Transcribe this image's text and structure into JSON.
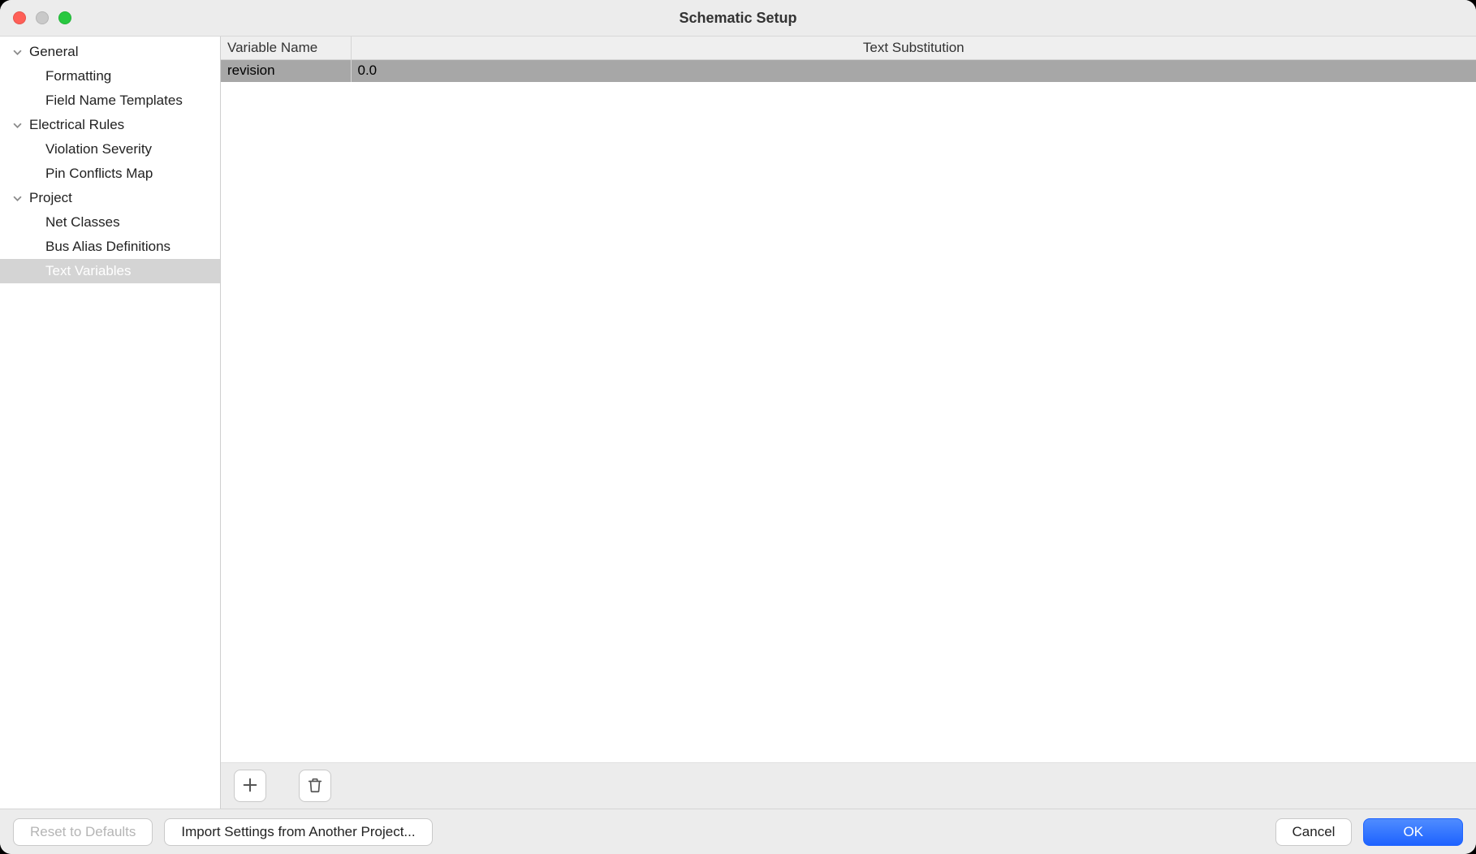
{
  "window": {
    "title": "Schematic Setup"
  },
  "sidebar": {
    "sections": [
      {
        "label": "General",
        "expanded": true,
        "items": [
          {
            "label": "Formatting",
            "selected": false
          },
          {
            "label": "Field Name Templates",
            "selected": false
          }
        ]
      },
      {
        "label": "Electrical Rules",
        "expanded": true,
        "items": [
          {
            "label": "Violation Severity",
            "selected": false
          },
          {
            "label": "Pin Conflicts Map",
            "selected": false
          }
        ]
      },
      {
        "label": "Project",
        "expanded": true,
        "items": [
          {
            "label": "Net Classes",
            "selected": false
          },
          {
            "label": "Bus Alias Definitions",
            "selected": false
          },
          {
            "label": "Text Variables",
            "selected": true
          }
        ]
      }
    ]
  },
  "table": {
    "headers": {
      "name": "Variable Name",
      "value": "Text Substitution"
    },
    "rows": [
      {
        "name": "revision",
        "value": "0.0",
        "selected": true
      }
    ]
  },
  "toolbar": {
    "add_icon": "plus-icon",
    "delete_icon": "trash-icon"
  },
  "footer": {
    "reset_label": "Reset to Defaults",
    "import_label": "Import Settings from Another Project...",
    "cancel_label": "Cancel",
    "ok_label": "OK"
  }
}
